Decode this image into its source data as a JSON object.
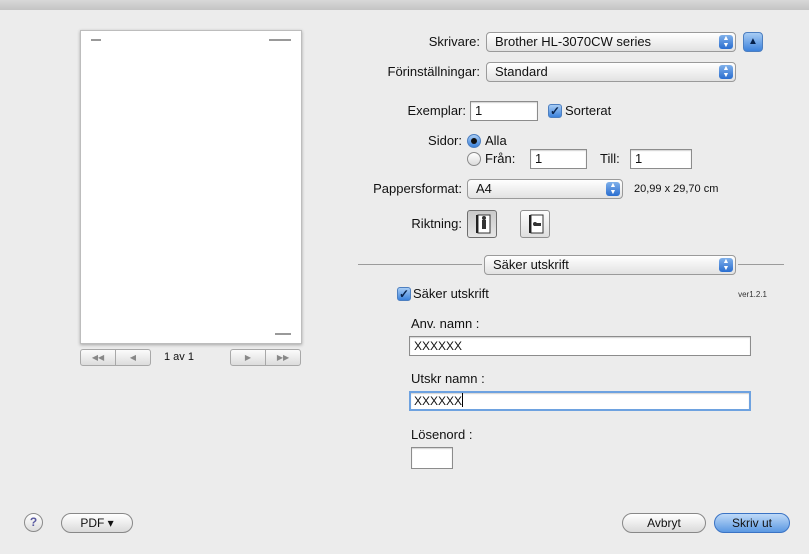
{
  "preview": {
    "page_counter": "1 av 1",
    "nav_first": "◀◀",
    "nav_prev": "◀",
    "nav_next": "▶",
    "nav_last": "▶▶"
  },
  "printer": {
    "label": "Skrivare:",
    "value": "Brother HL-3070CW series"
  },
  "presets": {
    "label": "Förinställningar:",
    "value": "Standard"
  },
  "copies": {
    "label": "Exemplar:",
    "value": "1",
    "collate_label": "Sorterat",
    "collate_checked": true
  },
  "pages": {
    "label": "Sidor:",
    "all_label": "Alla",
    "from_label": "Från:",
    "from_value": "1",
    "to_label": "Till:",
    "to_value": "1",
    "selected": "Alla"
  },
  "paper": {
    "label": "Pappersformat:",
    "value": "A4",
    "size": "20,99 x 29,70 cm"
  },
  "orientation": {
    "label": "Riktning:",
    "selected": "portrait"
  },
  "section": {
    "value": "Säker utskrift"
  },
  "secure": {
    "label": "Säker utskrift",
    "checked": true,
    "version": "ver1.2.1",
    "user_label": "Anv. namn :",
    "user_value": "XXXXXX",
    "job_label": "Utskr namn :",
    "job_value": "XXXXXX",
    "password_label": "Lösenord :",
    "password_value": ""
  },
  "footer": {
    "help": "?",
    "pdf": "PDF ▾",
    "cancel": "Avbryt",
    "print": "Skriv ut"
  },
  "colors": {
    "accent": "#3c82dc",
    "window": "#ececec"
  },
  "icons": {
    "printer_arrows": "up-down-arrows-icon",
    "collapse": "triangle-up-icon",
    "portrait": "portrait-orientation-icon",
    "landscape": "landscape-orientation-icon",
    "help": "question-icon"
  }
}
